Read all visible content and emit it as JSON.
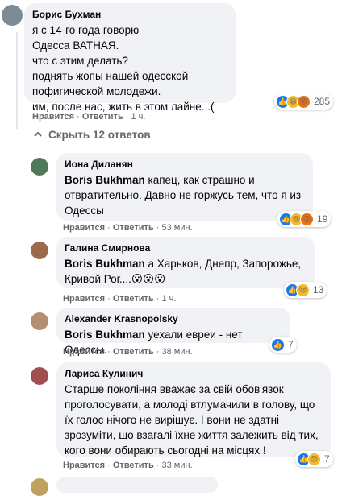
{
  "comments": [
    {
      "author": "Борис Бухман",
      "text": "я с 14-го года говорю -\nОдесса ВАТНАЯ.\nчто с этим делать?\nподнять жопы нашей одесской\nпофигической молодежи.\nим, после нас, жить в этом лайне...(",
      "like": "Нравится",
      "reply": "Ответить",
      "time": "1 ч.",
      "reactions_count": "285",
      "reaction_icons": [
        "like-icon",
        "haha-icon",
        "angry-icon"
      ]
    }
  ],
  "replies_toggle": "Скрыть 12 ответов",
  "replies": [
    {
      "author": "Иона Диланян",
      "mention": "Boris Bukhman",
      "text": " капец, как страшно и отвратительно. Давно не горжусь тем, что я из Одессы",
      "like": "Нравится",
      "reply": "Ответить",
      "time": "53 мин.",
      "reactions_count": "19",
      "reaction_icons": [
        "like-icon",
        "sad-icon",
        "angry-icon"
      ]
    },
    {
      "author": "Галина Смирнова",
      "mention": "Boris Bukhman",
      "text": " а Харьков, Днепр, Запорожье, Кривой Рог....😮😮😮",
      "like": "Нравится",
      "reply": "Ответить",
      "time": "1 ч.",
      "reactions_count": "13",
      "reaction_icons": [
        "like-icon",
        "sad-icon"
      ]
    },
    {
      "author": "Alexander Krasnopolsky",
      "mention": "Boris Bukhman",
      "text": " уехали евреи - нет Одессы.",
      "like": "Нравится",
      "reply": "Ответить",
      "time": "38 мин.",
      "reactions_count": "7",
      "reaction_icons": [
        "like-icon"
      ]
    },
    {
      "author": "Лариса Кулинич",
      "text": "Старше покоління вважає за свій обов'язок проголосувати, а молоді втлумачили в голову, що їх голос нічого не вирішує. І вони не здатні зрозуміти, що взагалі їхне життя залежить від тих, кого вони обирають сьогодні на місцях !",
      "like": "Нравится",
      "reply": "Ответить",
      "time": "33 мин.",
      "reactions_count": "7",
      "reaction_icons": [
        "like-icon",
        "sad-icon"
      ]
    }
  ],
  "colors": {
    "bubble": "#f0f2f5",
    "meta": "#65676b",
    "like_blue": "#1877f2",
    "emoji_yellow": "#f7b928"
  }
}
